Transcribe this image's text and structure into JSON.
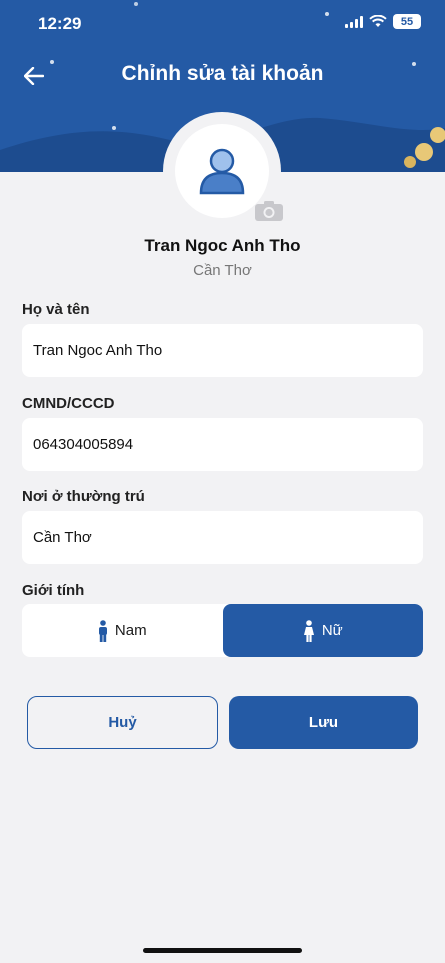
{
  "status_bar": {
    "time": "12:29",
    "battery": "55"
  },
  "header": {
    "title": "Chỉnh sửa tài khoản"
  },
  "profile": {
    "name": "Tran Ngoc Anh Tho",
    "city": "Cần Thơ"
  },
  "form": {
    "full_name": {
      "label": "Họ và tên",
      "value": "Tran Ngoc Anh Tho"
    },
    "id_number": {
      "label": "CMND/CCCD",
      "value": "064304005894"
    },
    "address": {
      "label": "Nơi ở thường trú",
      "value": "Cần Thơ"
    },
    "gender": {
      "label": "Giới tính",
      "options": [
        "Nam",
        "Nữ"
      ],
      "selected": "Nữ"
    }
  },
  "actions": {
    "cancel_label": "Huỷ",
    "save_label": "Lưu"
  },
  "colors": {
    "primary": "#245aa5",
    "background": "#f2f2f4"
  }
}
